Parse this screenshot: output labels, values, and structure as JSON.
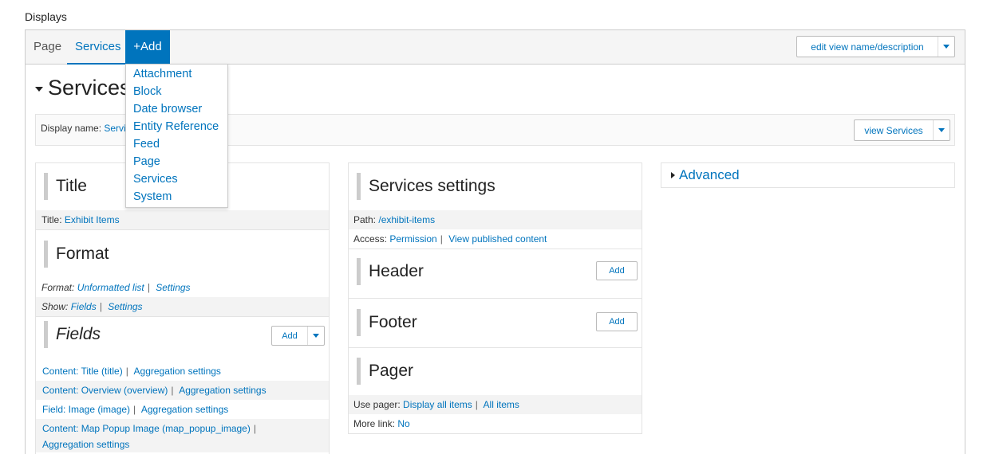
{
  "section_label": "Displays",
  "tabs": {
    "page": "Page",
    "services": "Services",
    "add": "+Add"
  },
  "edit_view_button": "edit view name/description",
  "add_menu": [
    "Attachment",
    "Block",
    "Date browser",
    "Entity Reference",
    "Feed",
    "Page",
    "Services",
    "System"
  ],
  "display_heading": "Services",
  "display_name": {
    "label": "Display name:",
    "value": "Services"
  },
  "view_services_button": "view Services",
  "left": {
    "title_heading": "Title",
    "title_row": {
      "label": "Title:",
      "value": "Exhibit Items"
    },
    "format_heading": "Format",
    "format_row": {
      "label": "Format:",
      "value": "Unformatted list",
      "settings": "Settings"
    },
    "show_row": {
      "label": "Show:",
      "value": "Fields",
      "settings": "Settings"
    },
    "fields_heading": "Fields",
    "fields_add": "Add",
    "fields": [
      {
        "name": "Content: Title (title)",
        "agg": "Aggregation settings"
      },
      {
        "name": "Content: Overview (overview)",
        "agg": "Aggregation settings"
      },
      {
        "name": "Field: Image (image)",
        "agg": "Aggregation settings"
      },
      {
        "name": "Content: Map Popup Image (map_popup_image)",
        "agg": "Aggregation settings"
      }
    ]
  },
  "middle": {
    "settings_heading": "Services settings",
    "path_row": {
      "label": "Path:",
      "value": "/exhibit-items"
    },
    "access_row": {
      "label": "Access:",
      "value": "Permission",
      "extra": "View published content"
    },
    "header_heading": "Header",
    "header_add": "Add",
    "footer_heading": "Footer",
    "footer_add": "Add",
    "pager_heading": "Pager",
    "pager_row": {
      "label": "Use pager:",
      "value": "Display all items",
      "extra": "All items"
    },
    "more_row": {
      "label": "More link:",
      "value": "No"
    }
  },
  "right": {
    "advanced": "Advanced"
  },
  "colors": {
    "link": "#0074bd",
    "active_tab_bg": "#0074bd"
  }
}
